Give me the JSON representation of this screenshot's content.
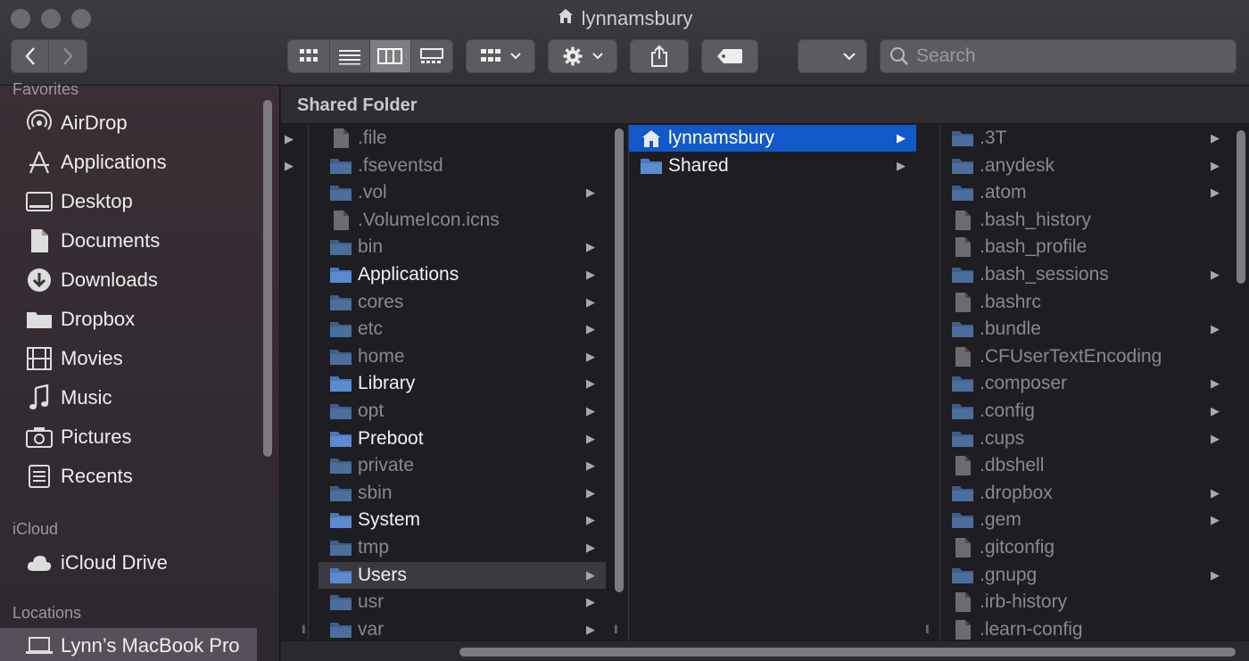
{
  "window": {
    "title": "lynnamsbury"
  },
  "toolbar": {
    "search_placeholder": "Search"
  },
  "sidebar": {
    "favorites_heading": "Favorites",
    "favorites": [
      {
        "label": "AirDrop",
        "icon": "airdrop-icon"
      },
      {
        "label": "Applications",
        "icon": "applications-icon"
      },
      {
        "label": "Desktop",
        "icon": "desktop-icon"
      },
      {
        "label": "Documents",
        "icon": "documents-icon"
      },
      {
        "label": "Downloads",
        "icon": "downloads-icon"
      },
      {
        "label": "Dropbox",
        "icon": "folder-icon"
      },
      {
        "label": "Movies",
        "icon": "movies-icon"
      },
      {
        "label": "Music",
        "icon": "music-icon"
      },
      {
        "label": "Pictures",
        "icon": "pictures-icon"
      },
      {
        "label": "Recents",
        "icon": "recents-icon"
      }
    ],
    "icloud_heading": "iCloud",
    "icloud": [
      {
        "label": "iCloud Drive",
        "icon": "cloud-icon"
      }
    ],
    "locations_heading": "Locations",
    "locations": [
      {
        "label": "Lynn’s MacBook Pro",
        "icon": "laptop-icon"
      }
    ]
  },
  "pathbar": {
    "label": "Shared Folder"
  },
  "column1": [
    {
      "name": ".file",
      "hidden": true,
      "folder": false,
      "chevron": false
    },
    {
      "name": ".fseventsd",
      "hidden": true,
      "folder": true,
      "chevron": false
    },
    {
      "name": ".vol",
      "hidden": true,
      "folder": true,
      "chevron": true
    },
    {
      "name": ".VolumeIcon.icns",
      "hidden": true,
      "folder": false,
      "chevron": false
    },
    {
      "name": "bin",
      "hidden": true,
      "folder": true,
      "chevron": true
    },
    {
      "name": "Applications",
      "hidden": false,
      "folder": true,
      "chevron": true
    },
    {
      "name": "cores",
      "hidden": true,
      "folder": true,
      "chevron": true
    },
    {
      "name": "etc",
      "hidden": true,
      "folder": true,
      "chevron": true
    },
    {
      "name": "home",
      "hidden": true,
      "folder": true,
      "chevron": true
    },
    {
      "name": "Library",
      "hidden": false,
      "folder": true,
      "chevron": true
    },
    {
      "name": "opt",
      "hidden": true,
      "folder": true,
      "chevron": true
    },
    {
      "name": "Preboot",
      "hidden": false,
      "folder": true,
      "chevron": true
    },
    {
      "name": "private",
      "hidden": true,
      "folder": true,
      "chevron": true
    },
    {
      "name": "sbin",
      "hidden": true,
      "folder": true,
      "chevron": true
    },
    {
      "name": "System",
      "hidden": false,
      "folder": true,
      "chevron": true
    },
    {
      "name": "tmp",
      "hidden": true,
      "folder": true,
      "chevron": true
    },
    {
      "name": "Users",
      "hidden": false,
      "folder": true,
      "chevron": true,
      "selected": true
    },
    {
      "name": "usr",
      "hidden": true,
      "folder": true,
      "chevron": true
    },
    {
      "name": "var",
      "hidden": true,
      "folder": true,
      "chevron": true
    }
  ],
  "column2": [
    {
      "name": "lynnamsbury",
      "hidden": false,
      "folder": true,
      "home": true,
      "chevron": true,
      "selected": true
    },
    {
      "name": "Shared",
      "hidden": false,
      "folder": true,
      "chevron": true
    }
  ],
  "column3": [
    {
      "name": ".3T",
      "folder": true,
      "chevron": true
    },
    {
      "name": ".anydesk",
      "folder": true,
      "chevron": true
    },
    {
      "name": ".atom",
      "folder": true,
      "chevron": true
    },
    {
      "name": ".bash_history",
      "folder": false,
      "chevron": false
    },
    {
      "name": ".bash_profile",
      "folder": false,
      "chevron": false
    },
    {
      "name": ".bash_sessions",
      "folder": true,
      "chevron": true
    },
    {
      "name": ".bashrc",
      "folder": false,
      "chevron": false
    },
    {
      "name": ".bundle",
      "folder": true,
      "chevron": true
    },
    {
      "name": ".CFUserTextEncoding",
      "folder": false,
      "chevron": false
    },
    {
      "name": ".composer",
      "folder": true,
      "chevron": true
    },
    {
      "name": ".config",
      "folder": true,
      "chevron": true
    },
    {
      "name": ".cups",
      "folder": true,
      "chevron": true
    },
    {
      "name": ".dbshell",
      "folder": false,
      "chevron": false
    },
    {
      "name": ".dropbox",
      "folder": true,
      "chevron": true
    },
    {
      "name": ".gem",
      "folder": true,
      "chevron": true
    },
    {
      "name": ".gitconfig",
      "folder": false,
      "chevron": false
    },
    {
      "name": ".gnupg",
      "folder": true,
      "chevron": true
    },
    {
      "name": ".irb-history",
      "folder": false,
      "chevron": false
    },
    {
      "name": ".learn-config",
      "folder": false,
      "chevron": false
    }
  ],
  "colors": {
    "selection_blue": "#1159c9",
    "folder_blue": "#4a78b6"
  }
}
